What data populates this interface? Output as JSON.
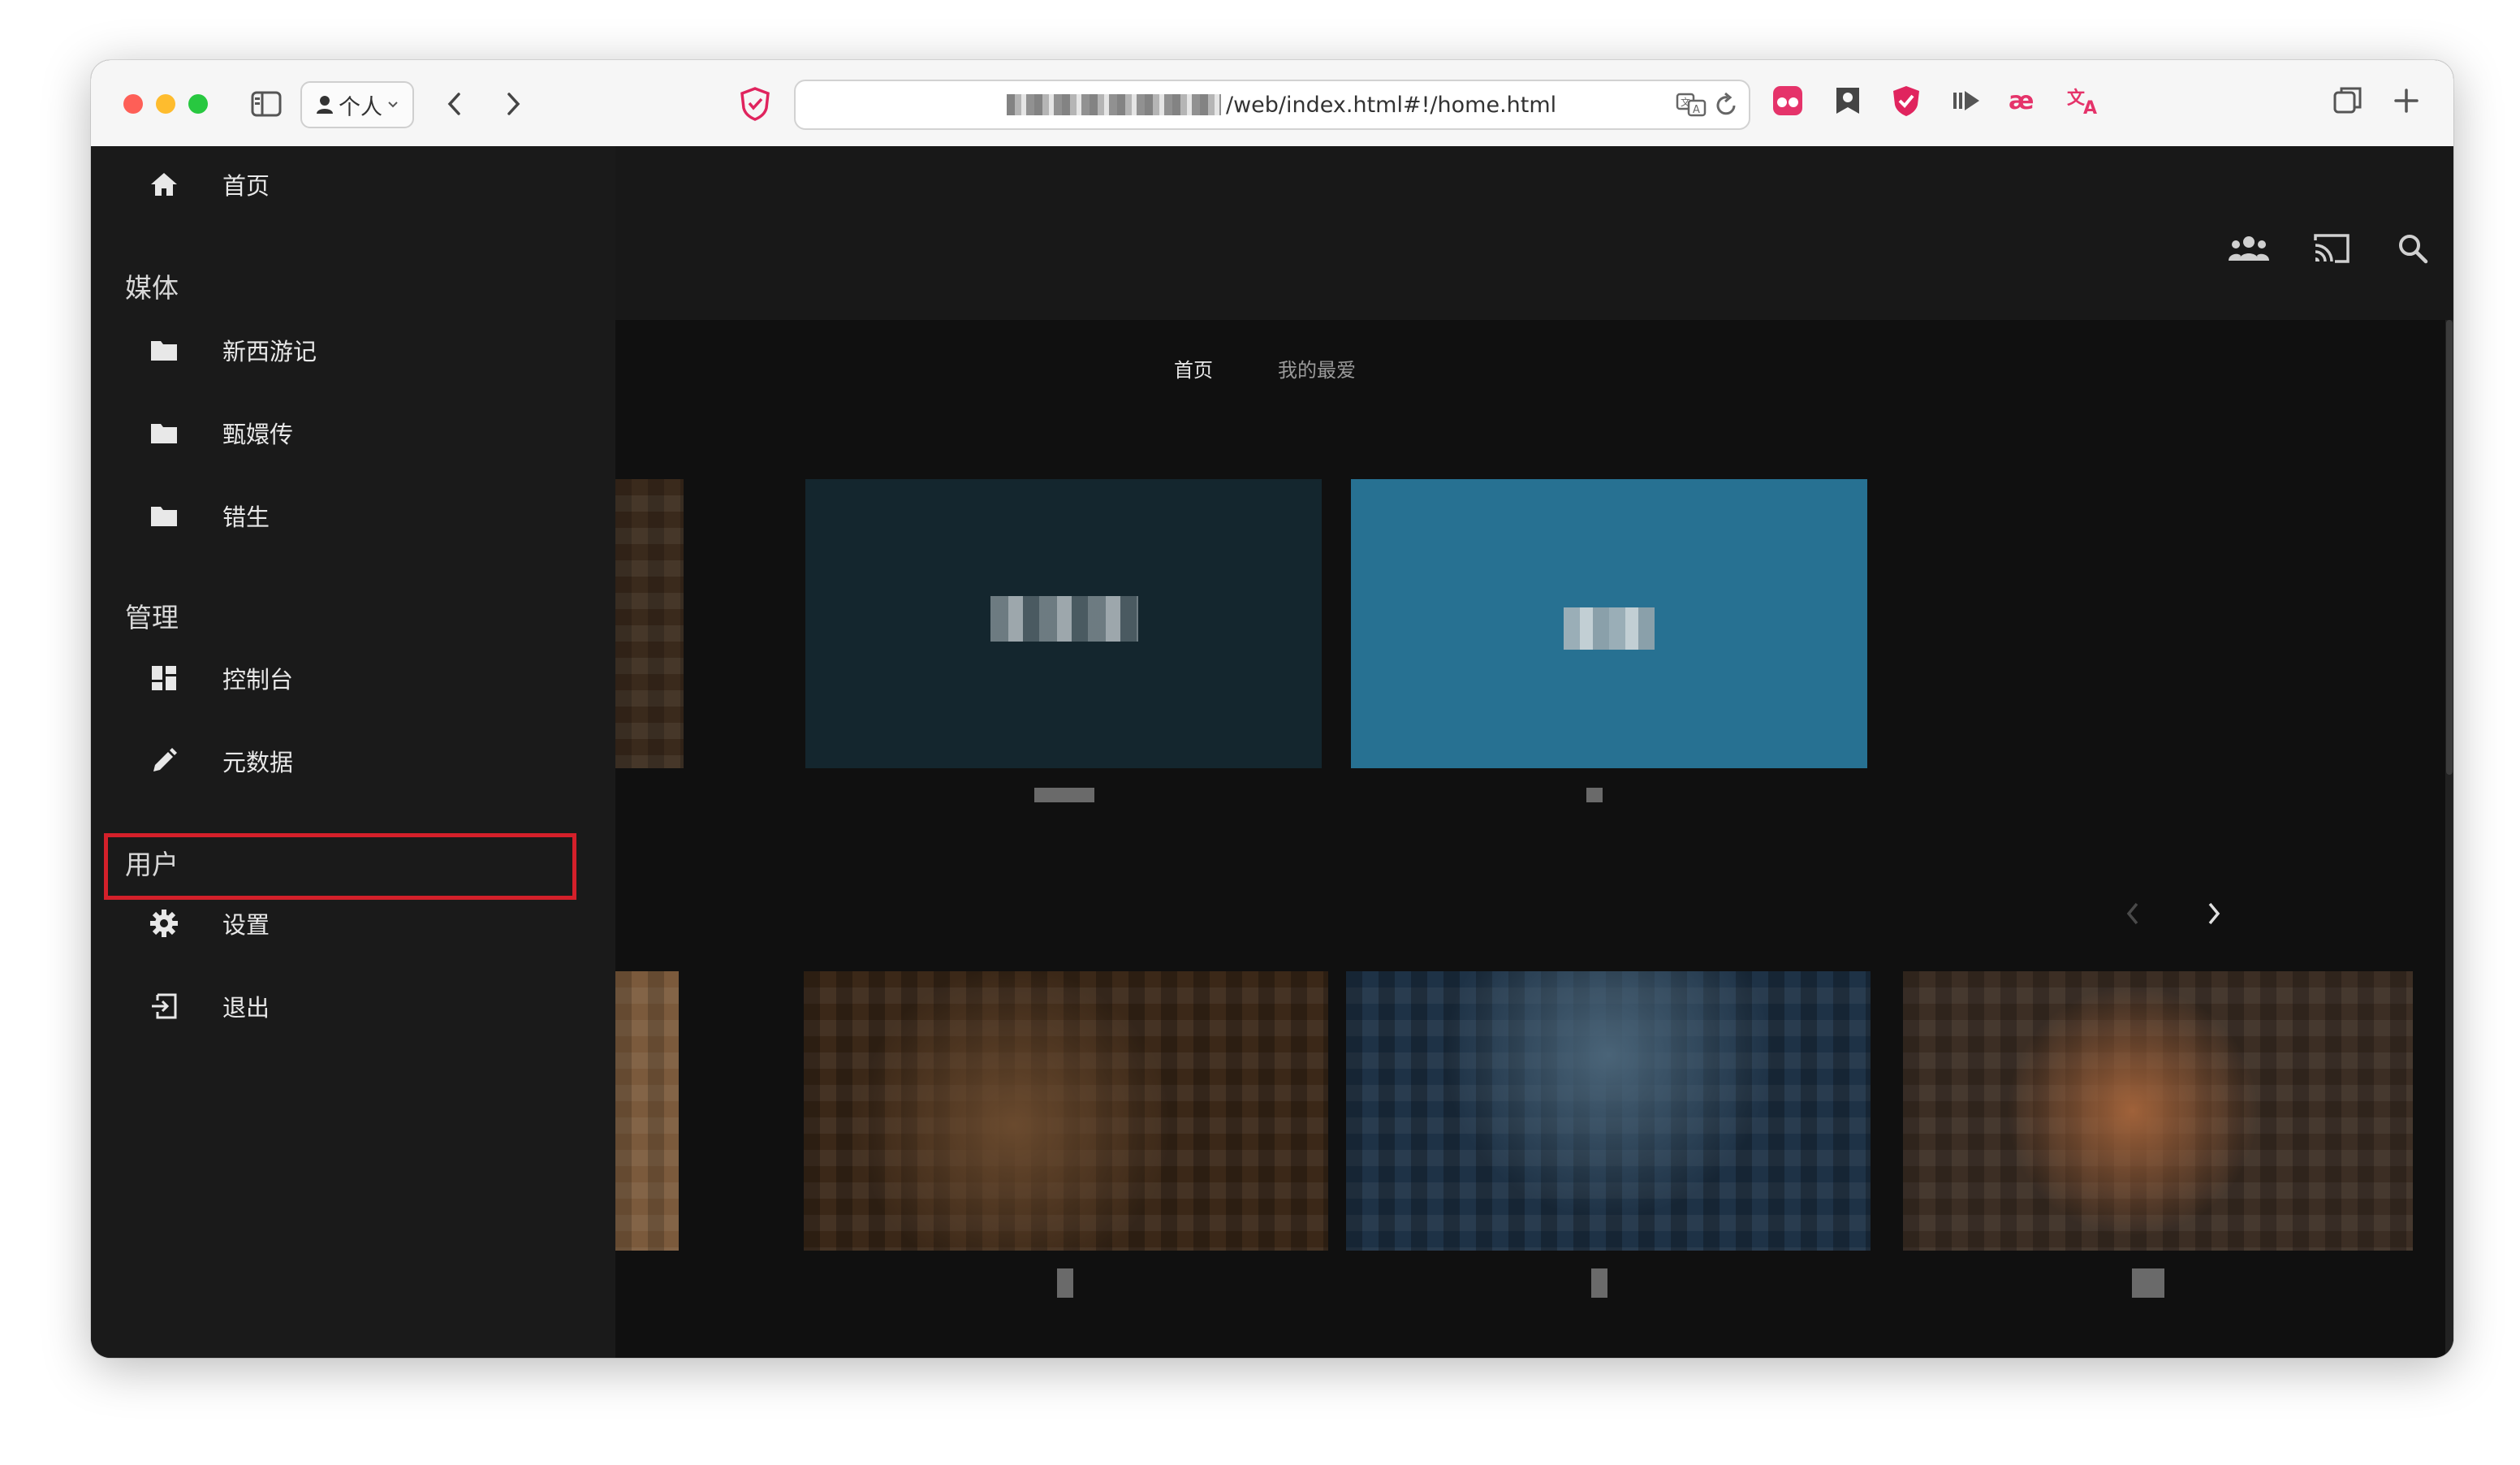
{
  "browser": {
    "profile_label": "个人",
    "url_suffix": "/web/index.html#!/home.html"
  },
  "sidebar": {
    "home_label": "首页",
    "sections": {
      "media": "媒体",
      "admin": "管理",
      "user": "用户"
    },
    "media_items": [
      {
        "label": "新西游记"
      },
      {
        "label": "甄嬛传"
      },
      {
        "label": "错生"
      }
    ],
    "admin_items": [
      {
        "label": "控制台"
      },
      {
        "label": "元数据"
      }
    ],
    "user_items": [
      {
        "label": "设置"
      },
      {
        "label": "退出"
      }
    ]
  },
  "tabs": [
    {
      "label": "首页",
      "active": true
    },
    {
      "label": "我的最爱",
      "active": false
    }
  ],
  "colors": {
    "highlight_box": "#d4202a",
    "library_tile_dark": "#14262e",
    "library_tile_blue": "#277192"
  },
  "icons": {
    "header": [
      "users-icon",
      "cast-icon",
      "search-icon",
      "user-icon"
    ],
    "sidebar": [
      "home-icon",
      "folder-icon",
      "dashboard-icon",
      "edit-icon",
      "gear-icon",
      "logout-icon"
    ]
  }
}
